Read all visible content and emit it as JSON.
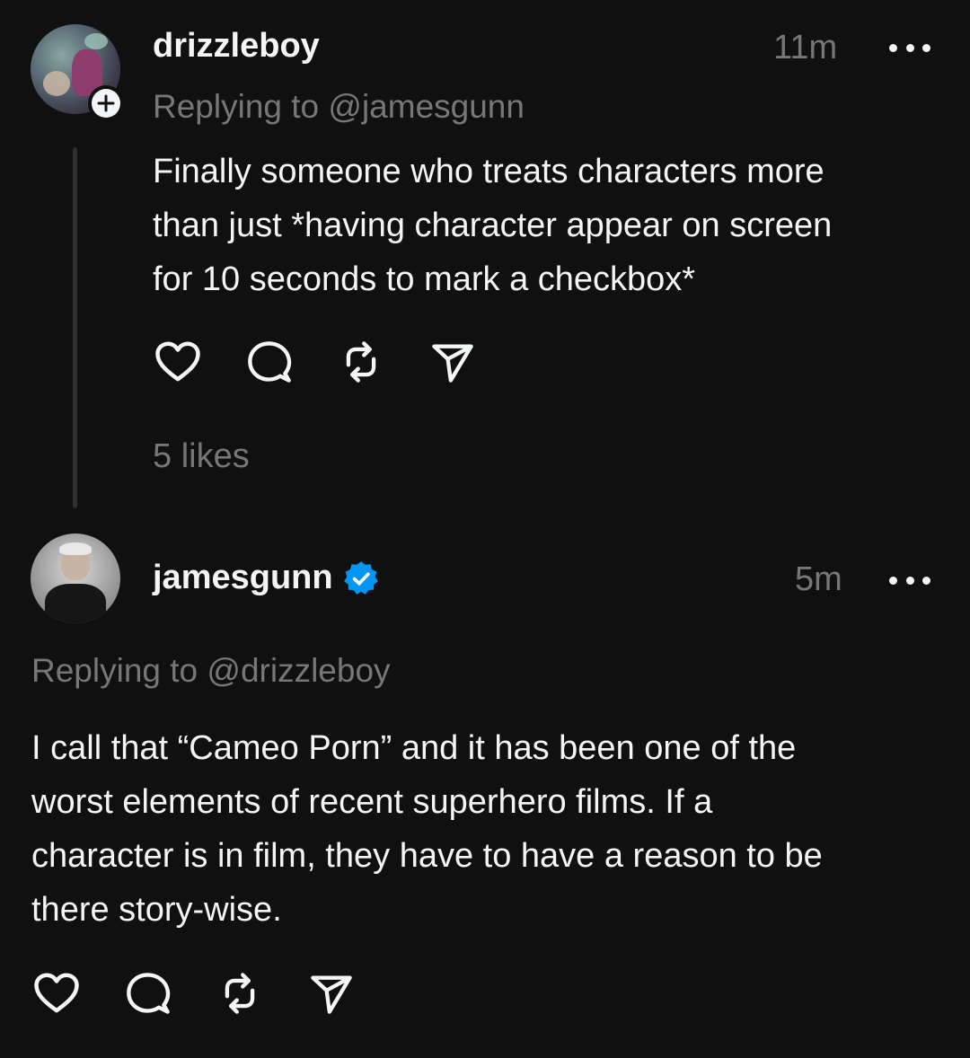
{
  "reply": {
    "username": "drizzleboy",
    "time": "11m",
    "replying_to": "Replying to @jamesgunn",
    "text_lines": [
      "Finally someone who treats characters more",
      "than just *having character appear on screen",
      "for 10 seconds to mark a checkbox*"
    ],
    "likes": "5 likes"
  },
  "response": {
    "username": "jamesgunn",
    "verified": true,
    "time": "5m",
    "replying_to": "Replying to @drizzleboy",
    "text_lines": [
      "I call that “Cameo Porn” and it has been one of the",
      "worst elements of recent superhero films. If a",
      "character is in film, they have to have a reason to be",
      "there story-wise."
    ]
  },
  "icons": {
    "like": "heart-icon",
    "reply": "comment-icon",
    "repost": "repost-icon",
    "share": "send-icon",
    "more": "more-icon",
    "follow": "plus-icon",
    "verified": "verified-badge-icon"
  },
  "colors": {
    "background": "#101010",
    "text": "#f3f5f7",
    "muted": "#777777",
    "thread_line": "#2e2e2e",
    "verified": "#0095f6"
  }
}
